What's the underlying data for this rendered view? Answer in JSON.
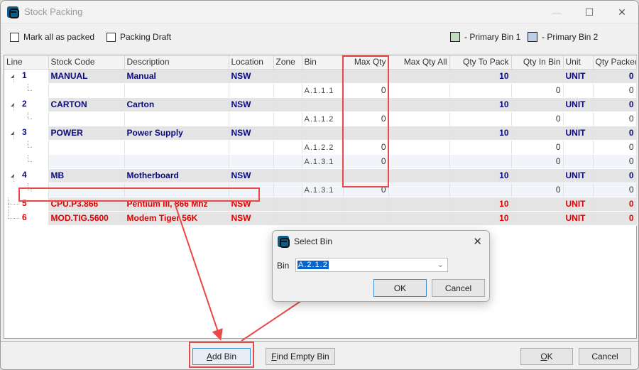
{
  "window": {
    "title": "Stock Packing",
    "controls": {
      "minimize": "—",
      "maximize": "☐",
      "close": "✕"
    }
  },
  "options": {
    "mark_all_packed": {
      "label": "Mark all as packed",
      "checked": false
    },
    "packing_draft": {
      "label": "Packing Draft",
      "checked": false
    }
  },
  "legend": [
    {
      "label": "- Primary Bin 1",
      "color": "#c2dcc2"
    },
    {
      "label": "- Primary Bin 2",
      "color": "#bdd0e9"
    }
  ],
  "grid": {
    "columns": [
      "Line",
      "Stock Code",
      "Description",
      "Location",
      "Zone",
      "Bin",
      "Max Qty",
      "Max Qty All",
      "Qty To Pack",
      "Qty In Bin",
      "Unit",
      "Qty Packed"
    ],
    "rows": [
      {
        "type": "parent",
        "line": "1",
        "stock_code": "MANUAL",
        "description": "Manual",
        "location": "NSW",
        "zone": "",
        "bin": "",
        "max_qty": "",
        "max_qty_all": "",
        "qty_to_pack": "10",
        "qty_in_bin": "",
        "unit": "UNIT",
        "qty_packed": "0"
      },
      {
        "type": "child",
        "line": "",
        "stock_code": "",
        "description": "",
        "location": "",
        "zone": "",
        "bin": "A.1.1.1",
        "max_qty": "0",
        "max_qty_all": "",
        "qty_to_pack": "",
        "qty_in_bin": "0",
        "unit": "",
        "qty_packed": "0"
      },
      {
        "type": "parent",
        "line": "2",
        "stock_code": "CARTON",
        "description": "Carton",
        "location": "NSW",
        "zone": "",
        "bin": "",
        "max_qty": "",
        "max_qty_all": "",
        "qty_to_pack": "10",
        "qty_in_bin": "",
        "unit": "UNIT",
        "qty_packed": "0"
      },
      {
        "type": "child",
        "line": "",
        "stock_code": "",
        "description": "",
        "location": "",
        "zone": "",
        "bin": "A.1.1.2",
        "max_qty": "0",
        "max_qty_all": "",
        "qty_to_pack": "",
        "qty_in_bin": "0",
        "unit": "",
        "qty_packed": "0"
      },
      {
        "type": "parent",
        "line": "3",
        "stock_code": "POWER",
        "description": "Power Supply",
        "location": "NSW",
        "zone": "",
        "bin": "",
        "max_qty": "",
        "max_qty_all": "",
        "qty_to_pack": "10",
        "qty_in_bin": "",
        "unit": "UNIT",
        "qty_packed": "0"
      },
      {
        "type": "child",
        "line": "",
        "stock_code": "",
        "description": "",
        "location": "",
        "zone": "",
        "bin": "A.1.2.2",
        "max_qty": "0",
        "max_qty_all": "",
        "qty_to_pack": "",
        "qty_in_bin": "0",
        "unit": "",
        "qty_packed": "0"
      },
      {
        "type": "child-alt",
        "line": "",
        "stock_code": "",
        "description": "",
        "location": "",
        "zone": "",
        "bin": "A.1.3.1",
        "max_qty": "0",
        "max_qty_all": "",
        "qty_to_pack": "",
        "qty_in_bin": "0",
        "unit": "",
        "qty_packed": "0"
      },
      {
        "type": "parent",
        "line": "4",
        "stock_code": "MB",
        "description": "Motherboard",
        "location": "NSW",
        "zone": "",
        "bin": "",
        "max_qty": "",
        "max_qty_all": "",
        "qty_to_pack": "10",
        "qty_in_bin": "",
        "unit": "UNIT",
        "qty_packed": "0"
      },
      {
        "type": "child-alt",
        "line": "",
        "stock_code": "",
        "description": "",
        "location": "",
        "zone": "",
        "bin": "A.1.3.1",
        "max_qty": "0",
        "max_qty_all": "",
        "qty_to_pack": "",
        "qty_in_bin": "0",
        "unit": "",
        "qty_packed": "0"
      },
      {
        "type": "error",
        "line": "5",
        "stock_code": "CPU.P3.866",
        "description": "Pentium III, 866 Mhz",
        "location": "NSW",
        "zone": "",
        "bin": "",
        "max_qty": "",
        "max_qty_all": "",
        "qty_to_pack": "10",
        "qty_in_bin": "",
        "unit": "UNIT",
        "qty_packed": "0"
      },
      {
        "type": "error",
        "line": "6",
        "stock_code": "MOD.TIG.5600",
        "description": "Modem Tiger 56K",
        "location": "NSW",
        "zone": "",
        "bin": "",
        "max_qty": "",
        "max_qty_all": "",
        "qty_to_pack": "10",
        "qty_in_bin": "",
        "unit": "UNIT",
        "qty_packed": "0"
      }
    ]
  },
  "dialog": {
    "title": "Select Bin",
    "close": "✕",
    "bin_label": "Bin",
    "bin_value": "A.2.1.2",
    "ok_label": "OK",
    "cancel_label": "Cancel"
  },
  "footer": {
    "add_bin": {
      "accel": "A",
      "rest": "dd Bin"
    },
    "find_empty_bin": {
      "accel": "F",
      "rest": "ind Empty Bin"
    },
    "ok": {
      "accel": "O",
      "rest": "K"
    },
    "cancel": "Cancel"
  },
  "colors": {
    "annotation": "#e84848",
    "parent_text": "#0a0a80",
    "error_text": "#e00000"
  }
}
